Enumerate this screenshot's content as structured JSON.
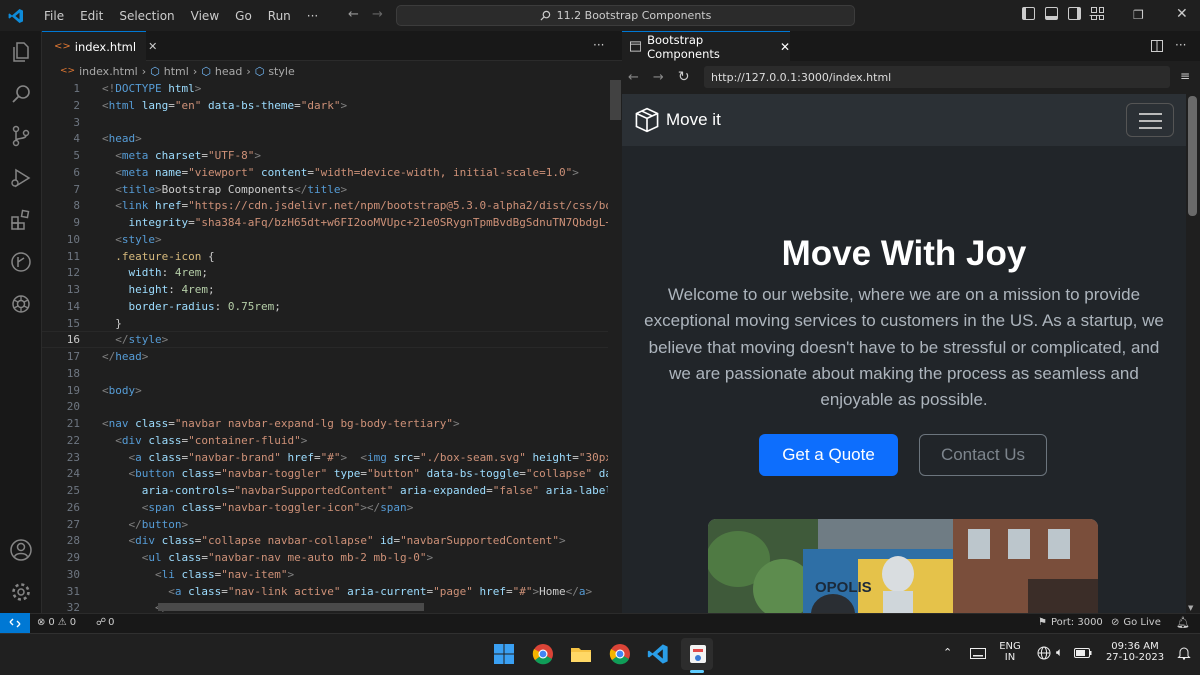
{
  "titlebar": {
    "menu": [
      "File",
      "Edit",
      "Selection",
      "View",
      "Go",
      "Run",
      "···"
    ],
    "command_center": "11.2 Bootstrap Components"
  },
  "editor": {
    "tab_label": "index.html",
    "breadcrumb": [
      "index.html",
      "html",
      "head",
      "style"
    ],
    "more": "···",
    "line_numbers": [
      "1",
      "2",
      "3",
      "4",
      "5",
      "6",
      "7",
      "8",
      "9",
      "10",
      "11",
      "12",
      "13",
      "14",
      "15",
      "16",
      "17",
      "18",
      "19",
      "20",
      "21",
      "22",
      "23",
      "24",
      "25",
      "26",
      "27",
      "28",
      "29",
      "30",
      "31",
      "32"
    ],
    "current_line": "16",
    "lines": [
      [
        [
          "<!",
          "br"
        ],
        [
          "DOCTYPE",
          "tag"
        ],
        [
          " html",
          "at"
        ],
        [
          ">",
          "br"
        ]
      ],
      [
        [
          "<",
          "br"
        ],
        [
          "html",
          "tag"
        ],
        [
          " lang",
          "at"
        ],
        [
          "=",
          "pu"
        ],
        [
          "\"en\"",
          "st"
        ],
        [
          " data-bs-theme",
          "at"
        ],
        [
          "=",
          "pu"
        ],
        [
          "\"dark\"",
          "st"
        ],
        [
          ">",
          "br"
        ]
      ],
      [],
      [
        [
          "<",
          "br"
        ],
        [
          "head",
          "tag"
        ],
        [
          ">",
          "br"
        ]
      ],
      [
        [
          "  <",
          "br"
        ],
        [
          "meta",
          "tag"
        ],
        [
          " charset",
          "at"
        ],
        [
          "=",
          "pu"
        ],
        [
          "\"UTF-8\"",
          "st"
        ],
        [
          ">",
          "br"
        ]
      ],
      [
        [
          "  <",
          "br"
        ],
        [
          "meta",
          "tag"
        ],
        [
          " name",
          "at"
        ],
        [
          "=",
          "pu"
        ],
        [
          "\"viewport\"",
          "st"
        ],
        [
          " content",
          "at"
        ],
        [
          "=",
          "pu"
        ],
        [
          "\"width=device-width, initial-scale=1.0\"",
          "st"
        ],
        [
          ">",
          "br"
        ]
      ],
      [
        [
          "  <",
          "br"
        ],
        [
          "title",
          "tag"
        ],
        [
          ">",
          "br"
        ],
        [
          "Bootstrap Components",
          "tx"
        ],
        [
          "</",
          "br"
        ],
        [
          "title",
          "tag"
        ],
        [
          ">",
          "br"
        ]
      ],
      [
        [
          "  <",
          "br"
        ],
        [
          "link",
          "tag"
        ],
        [
          " href",
          "at"
        ],
        [
          "=",
          "pu"
        ],
        [
          "\"https://cdn.jsdelivr.net/npm/bootstrap@5.3.0-alpha2/dist/css/bo",
          "st"
        ]
      ],
      [
        [
          "    integrity",
          "at"
        ],
        [
          "=",
          "pu"
        ],
        [
          "\"sha384-aFq/bzH65dt+w6FI2ooMVUpc+21e0SRygnTpmBvdBgSdnuTN7QbdgL+",
          "st"
        ]
      ],
      [
        [
          "  <",
          "br"
        ],
        [
          "style",
          "tag"
        ],
        [
          ">",
          "br"
        ]
      ],
      [
        [
          "  .feature-icon",
          "sel"
        ],
        [
          " {",
          "pu"
        ]
      ],
      [
        [
          "    width",
          "pr"
        ],
        [
          ": ",
          "pu"
        ],
        [
          "4rem",
          "nu"
        ],
        [
          ";",
          "pu"
        ]
      ],
      [
        [
          "    height",
          "pr"
        ],
        [
          ": ",
          "pu"
        ],
        [
          "4rem",
          "nu"
        ],
        [
          ";",
          "pu"
        ]
      ],
      [
        [
          "    border-radius",
          "pr"
        ],
        [
          ": ",
          "pu"
        ],
        [
          "0.75rem",
          "nu"
        ],
        [
          ";",
          "pu"
        ]
      ],
      [
        [
          "  }",
          "pu"
        ]
      ],
      [
        [
          "  </",
          "br"
        ],
        [
          "style",
          "tag"
        ],
        [
          ">",
          "br"
        ]
      ],
      [
        [
          "</",
          "br"
        ],
        [
          "head",
          "tag"
        ],
        [
          ">",
          "br"
        ]
      ],
      [],
      [
        [
          "<",
          "br"
        ],
        [
          "body",
          "tag"
        ],
        [
          ">",
          "br"
        ]
      ],
      [],
      [
        [
          "<",
          "br"
        ],
        [
          "nav",
          "tag"
        ],
        [
          " class",
          "at"
        ],
        [
          "=",
          "pu"
        ],
        [
          "\"navbar navbar-expand-lg bg-body-tertiary\"",
          "st"
        ],
        [
          ">",
          "br"
        ]
      ],
      [
        [
          "  <",
          "br"
        ],
        [
          "div",
          "tag"
        ],
        [
          " class",
          "at"
        ],
        [
          "=",
          "pu"
        ],
        [
          "\"container-fluid\"",
          "st"
        ],
        [
          ">",
          "br"
        ]
      ],
      [
        [
          "    <",
          "br"
        ],
        [
          "a",
          "tag"
        ],
        [
          " class",
          "at"
        ],
        [
          "=",
          "pu"
        ],
        [
          "\"navbar-brand\"",
          "st"
        ],
        [
          " href",
          "at"
        ],
        [
          "=",
          "pu"
        ],
        [
          "\"#\"",
          "st"
        ],
        [
          ">",
          "br"
        ],
        [
          "  <",
          "br"
        ],
        [
          "img",
          "tag"
        ],
        [
          " src",
          "at"
        ],
        [
          "=",
          "pu"
        ],
        [
          "\"./box-seam.svg\"",
          "st"
        ],
        [
          " height",
          "at"
        ],
        [
          "=",
          "pu"
        ],
        [
          "\"30px",
          "st"
        ]
      ],
      [
        [
          "    <",
          "br"
        ],
        [
          "button",
          "tag"
        ],
        [
          " class",
          "at"
        ],
        [
          "=",
          "pu"
        ],
        [
          "\"navbar-toggler\"",
          "st"
        ],
        [
          " type",
          "at"
        ],
        [
          "=",
          "pu"
        ],
        [
          "\"button\"",
          "st"
        ],
        [
          " data-bs-toggle",
          "at"
        ],
        [
          "=",
          "pu"
        ],
        [
          "\"collapse\"",
          "st"
        ],
        [
          " da",
          "at"
        ]
      ],
      [
        [
          "      aria-controls",
          "at"
        ],
        [
          "=",
          "pu"
        ],
        [
          "\"navbarSupportedContent\"",
          "st"
        ],
        [
          " aria-expanded",
          "at"
        ],
        [
          "=",
          "pu"
        ],
        [
          "\"false\"",
          "st"
        ],
        [
          " aria-label",
          "at"
        ]
      ],
      [
        [
          "      <",
          "br"
        ],
        [
          "span",
          "tag"
        ],
        [
          " class",
          "at"
        ],
        [
          "=",
          "pu"
        ],
        [
          "\"navbar-toggler-icon\"",
          "st"
        ],
        [
          "></",
          "br"
        ],
        [
          "span",
          "tag"
        ],
        [
          ">",
          "br"
        ]
      ],
      [
        [
          "    </",
          "br"
        ],
        [
          "button",
          "tag"
        ],
        [
          ">",
          "br"
        ]
      ],
      [
        [
          "    <",
          "br"
        ],
        [
          "div",
          "tag"
        ],
        [
          " class",
          "at"
        ],
        [
          "=",
          "pu"
        ],
        [
          "\"collapse navbar-collapse\"",
          "st"
        ],
        [
          " id",
          "at"
        ],
        [
          "=",
          "pu"
        ],
        [
          "\"navbarSupportedContent\"",
          "st"
        ],
        [
          ">",
          "br"
        ]
      ],
      [
        [
          "      <",
          "br"
        ],
        [
          "ul",
          "tag"
        ],
        [
          " class",
          "at"
        ],
        [
          "=",
          "pu"
        ],
        [
          "\"navbar-nav me-auto mb-2 mb-lg-0\"",
          "st"
        ],
        [
          ">",
          "br"
        ]
      ],
      [
        [
          "        <",
          "br"
        ],
        [
          "li",
          "tag"
        ],
        [
          " class",
          "at"
        ],
        [
          "=",
          "pu"
        ],
        [
          "\"nav-item\"",
          "st"
        ],
        [
          ">",
          "br"
        ]
      ],
      [
        [
          "          <",
          "br"
        ],
        [
          "a",
          "tag"
        ],
        [
          " class",
          "at"
        ],
        [
          "=",
          "pu"
        ],
        [
          "\"nav-link active\"",
          "st"
        ],
        [
          " aria-current",
          "at"
        ],
        [
          "=",
          "pu"
        ],
        [
          "\"page\"",
          "st"
        ],
        [
          " href",
          "at"
        ],
        [
          "=",
          "pu"
        ],
        [
          "\"#\"",
          "st"
        ],
        [
          ">",
          "br"
        ],
        [
          "Home",
          "tx"
        ],
        [
          "</",
          "br"
        ],
        [
          "a",
          "tag"
        ],
        [
          ">",
          "br"
        ]
      ],
      [
        [
          "        </",
          "br"
        ],
        [
          "li",
          "tag"
        ],
        [
          ">",
          "br"
        ]
      ]
    ]
  },
  "preview": {
    "tab_label": "Bootstrap Components",
    "url": "http://127.0.0.1:3000/index.html",
    "site": {
      "brand": "Move it",
      "heading": "Move With Joy",
      "lead": "Welcome to our website, where we are on a mission to provide exceptional moving services to customers in the US. As a startup, we believe that moving doesn't have to be stressful or complicated, and we are passionate about making the process as seamless and enjoyable as possible.",
      "primary_button": "Get a Quote",
      "secondary_button": "Contact Us",
      "image_text": "OPOLIS"
    }
  },
  "statusbar": {
    "errors": "0",
    "warnings": "0",
    "ports": "0",
    "port": "Port: 3000",
    "go_live": "Go Live"
  },
  "taskbar": {
    "lang_top": "ENG",
    "lang_bottom": "IN",
    "time": "09:36 AM",
    "date": "27-10-2023"
  },
  "colors": {
    "accent": "#0078d4",
    "bootstrap_primary": "#0d6efd",
    "site_background": "#212529"
  }
}
